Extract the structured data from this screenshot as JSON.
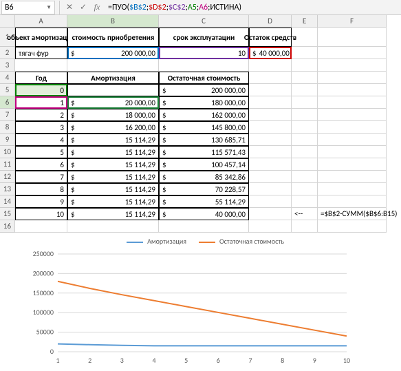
{
  "namebox": "B6",
  "formula": {
    "prefix": "=ПУО(",
    "b2": "$B$2",
    "d2": "$D$2",
    "c2": "$C$2",
    "a5": "A5",
    "a6": "A6",
    "tail": ";ИСТИНА)"
  },
  "cols": [
    "A",
    "B",
    "C",
    "D",
    "E",
    "F"
  ],
  "rowcount": 26,
  "headers": {
    "a1": "объект амортизации",
    "b1": "стоимость приобретения",
    "c1": "срок эксплуатации",
    "d1": "Остаток средств"
  },
  "row2": {
    "a": "тягач фур",
    "b_cur": "$",
    "b_val": "200 000,00",
    "c": "10",
    "d_cur": "$",
    "d_val": "40 000,00"
  },
  "headers2": {
    "a4": "Год",
    "b4": "Амортизация",
    "c4": "Остаточная стоимость"
  },
  "table": [
    {
      "year": "0",
      "amort": "",
      "rem": "200 000,00"
    },
    {
      "year": "1",
      "amort": "20 000,00",
      "rem": "180 000,00"
    },
    {
      "year": "2",
      "amort": "18 000,00",
      "rem": "162 000,00"
    },
    {
      "year": "3",
      "amort": "16 200,00",
      "rem": "145 800,00"
    },
    {
      "year": "4",
      "amort": "15 114,29",
      "rem": "130 685,71"
    },
    {
      "year": "5",
      "amort": "15 114,29",
      "rem": "115 571,43"
    },
    {
      "year": "6",
      "amort": "15 114,29",
      "rem": "100 457,14"
    },
    {
      "year": "7",
      "amort": "15 114,29",
      "rem": "85 342,86"
    },
    {
      "year": "8",
      "amort": "15 114,29",
      "rem": "70 228,57"
    },
    {
      "year": "9",
      "amort": "15 114,29",
      "rem": "55 114,29"
    },
    {
      "year": "10",
      "amort": "15 114,29",
      "rem": "40 000,00"
    }
  ],
  "currency": "$",
  "e15": "<--",
  "f15": "=$B$2-СУММ($B$6:B15)",
  "legend": {
    "a": "Амортизация",
    "b": "Остаточная стоимость"
  },
  "chart_data": {
    "type": "line",
    "x": [
      1,
      2,
      3,
      4,
      5,
      6,
      7,
      8,
      9,
      10
    ],
    "series": [
      {
        "name": "Амортизация",
        "values": [
          20000,
          18000,
          16200,
          15114.29,
          15114.29,
          15114.29,
          15114.29,
          15114.29,
          15114.29,
          15114.29
        ]
      },
      {
        "name": "Остаточная стоимость",
        "values": [
          180000,
          162000,
          145800,
          130685.71,
          115571.43,
          100457.14,
          85342.86,
          70228.57,
          55114.29,
          40000
        ]
      }
    ],
    "ylim": [
      0,
      250000
    ],
    "yticks": [
      0,
      50000,
      100000,
      150000,
      200000,
      250000
    ],
    "xlabel": "",
    "ylabel": "",
    "title": ""
  }
}
